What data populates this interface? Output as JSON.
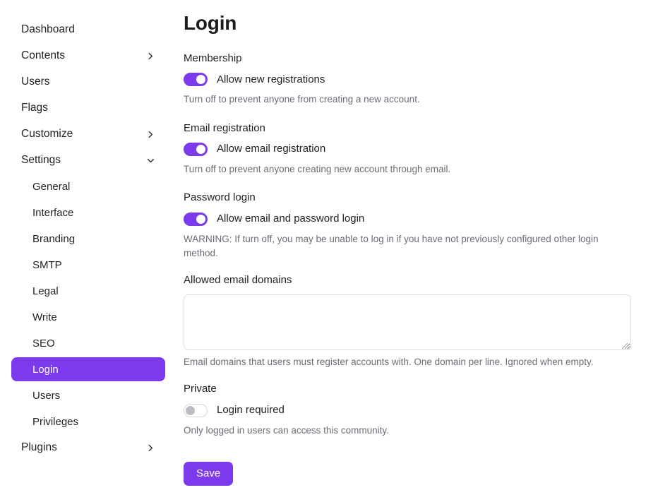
{
  "accent_color": "#7c3aed",
  "sidebar": {
    "items": [
      {
        "label": "Dashboard",
        "level": "top",
        "chevron": "none",
        "active": false
      },
      {
        "label": "Contents",
        "level": "top",
        "chevron": "chevron-right",
        "active": false
      },
      {
        "label": "Users",
        "level": "top",
        "chevron": "none",
        "active": false
      },
      {
        "label": "Flags",
        "level": "top",
        "chevron": "none",
        "active": false
      },
      {
        "label": "Customize",
        "level": "top",
        "chevron": "chevron-right",
        "active": false
      },
      {
        "label": "Settings",
        "level": "top",
        "chevron": "chevron-down",
        "active": false
      },
      {
        "label": "General",
        "level": "sub",
        "chevron": "none",
        "active": false
      },
      {
        "label": "Interface",
        "level": "sub",
        "chevron": "none",
        "active": false
      },
      {
        "label": "Branding",
        "level": "sub",
        "chevron": "none",
        "active": false
      },
      {
        "label": "SMTP",
        "level": "sub",
        "chevron": "none",
        "active": false
      },
      {
        "label": "Legal",
        "level": "sub",
        "chevron": "none",
        "active": false
      },
      {
        "label": "Write",
        "level": "sub",
        "chevron": "none",
        "active": false
      },
      {
        "label": "SEO",
        "level": "sub",
        "chevron": "none",
        "active": false
      },
      {
        "label": "Login",
        "level": "sub",
        "chevron": "none",
        "active": true
      },
      {
        "label": "Users",
        "level": "sub",
        "chevron": "none",
        "active": false
      },
      {
        "label": "Privileges",
        "level": "sub",
        "chevron": "none",
        "active": false
      },
      {
        "label": "Plugins",
        "level": "top",
        "chevron": "chevron-right",
        "active": false
      }
    ]
  },
  "main": {
    "page_title": "Login",
    "membership": {
      "section_label": "Membership",
      "toggle_label": "Allow new registrations",
      "toggle_state": "on",
      "help": "Turn off to prevent anyone from creating a new account."
    },
    "email_registration": {
      "section_label": "Email registration",
      "toggle_label": "Allow email registration",
      "toggle_state": "on",
      "help": "Turn off to prevent anyone creating new account through email."
    },
    "password_login": {
      "section_label": "Password login",
      "toggle_label": "Allow email and password login",
      "toggle_state": "on",
      "help": "WARNING: If turn off, you may be unable to log in if you have not previously configured other login method."
    },
    "allowed_email_domains": {
      "field_label": "Allowed email domains",
      "value": "",
      "placeholder": "",
      "help": "Email domains that users must register accounts with. One domain per line. Ignored when empty."
    },
    "private": {
      "section_label": "Private",
      "toggle_label": "Login required",
      "toggle_state": "off",
      "help": "Only logged in users can access this community."
    },
    "save_label": "Save"
  }
}
